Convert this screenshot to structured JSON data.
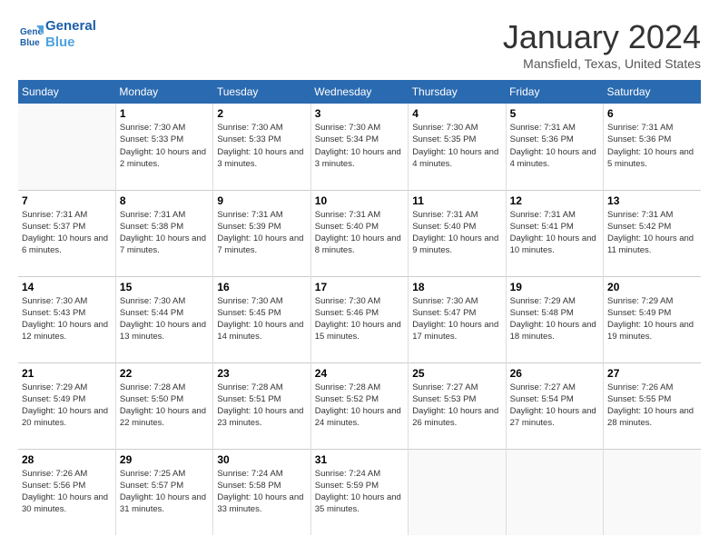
{
  "header": {
    "logo_line1": "General",
    "logo_line2": "Blue",
    "month": "January 2024",
    "location": "Mansfield, Texas, United States"
  },
  "days_of_week": [
    "Sunday",
    "Monday",
    "Tuesday",
    "Wednesday",
    "Thursday",
    "Friday",
    "Saturday"
  ],
  "weeks": [
    [
      {
        "day": "",
        "empty": true
      },
      {
        "day": "1",
        "sunrise": "7:30 AM",
        "sunset": "5:33 PM",
        "daylight": "10 hours and 2 minutes."
      },
      {
        "day": "2",
        "sunrise": "7:30 AM",
        "sunset": "5:33 PM",
        "daylight": "10 hours and 3 minutes."
      },
      {
        "day": "3",
        "sunrise": "7:30 AM",
        "sunset": "5:34 PM",
        "daylight": "10 hours and 3 minutes."
      },
      {
        "day": "4",
        "sunrise": "7:30 AM",
        "sunset": "5:35 PM",
        "daylight": "10 hours and 4 minutes."
      },
      {
        "day": "5",
        "sunrise": "7:31 AM",
        "sunset": "5:36 PM",
        "daylight": "10 hours and 4 minutes."
      },
      {
        "day": "6",
        "sunrise": "7:31 AM",
        "sunset": "5:36 PM",
        "daylight": "10 hours and 5 minutes."
      }
    ],
    [
      {
        "day": "7",
        "sunrise": "7:31 AM",
        "sunset": "5:37 PM",
        "daylight": "10 hours and 6 minutes."
      },
      {
        "day": "8",
        "sunrise": "7:31 AM",
        "sunset": "5:38 PM",
        "daylight": "10 hours and 7 minutes."
      },
      {
        "day": "9",
        "sunrise": "7:31 AM",
        "sunset": "5:39 PM",
        "daylight": "10 hours and 7 minutes."
      },
      {
        "day": "10",
        "sunrise": "7:31 AM",
        "sunset": "5:40 PM",
        "daylight": "10 hours and 8 minutes."
      },
      {
        "day": "11",
        "sunrise": "7:31 AM",
        "sunset": "5:40 PM",
        "daylight": "10 hours and 9 minutes."
      },
      {
        "day": "12",
        "sunrise": "7:31 AM",
        "sunset": "5:41 PM",
        "daylight": "10 hours and 10 minutes."
      },
      {
        "day": "13",
        "sunrise": "7:31 AM",
        "sunset": "5:42 PM",
        "daylight": "10 hours and 11 minutes."
      }
    ],
    [
      {
        "day": "14",
        "sunrise": "7:30 AM",
        "sunset": "5:43 PM",
        "daylight": "10 hours and 12 minutes."
      },
      {
        "day": "15",
        "sunrise": "7:30 AM",
        "sunset": "5:44 PM",
        "daylight": "10 hours and 13 minutes."
      },
      {
        "day": "16",
        "sunrise": "7:30 AM",
        "sunset": "5:45 PM",
        "daylight": "10 hours and 14 minutes."
      },
      {
        "day": "17",
        "sunrise": "7:30 AM",
        "sunset": "5:46 PM",
        "daylight": "10 hours and 15 minutes."
      },
      {
        "day": "18",
        "sunrise": "7:30 AM",
        "sunset": "5:47 PM",
        "daylight": "10 hours and 17 minutes."
      },
      {
        "day": "19",
        "sunrise": "7:29 AM",
        "sunset": "5:48 PM",
        "daylight": "10 hours and 18 minutes."
      },
      {
        "day": "20",
        "sunrise": "7:29 AM",
        "sunset": "5:49 PM",
        "daylight": "10 hours and 19 minutes."
      }
    ],
    [
      {
        "day": "21",
        "sunrise": "7:29 AM",
        "sunset": "5:49 PM",
        "daylight": "10 hours and 20 minutes."
      },
      {
        "day": "22",
        "sunrise": "7:28 AM",
        "sunset": "5:50 PM",
        "daylight": "10 hours and 22 minutes."
      },
      {
        "day": "23",
        "sunrise": "7:28 AM",
        "sunset": "5:51 PM",
        "daylight": "10 hours and 23 minutes."
      },
      {
        "day": "24",
        "sunrise": "7:28 AM",
        "sunset": "5:52 PM",
        "daylight": "10 hours and 24 minutes."
      },
      {
        "day": "25",
        "sunrise": "7:27 AM",
        "sunset": "5:53 PM",
        "daylight": "10 hours and 26 minutes."
      },
      {
        "day": "26",
        "sunrise": "7:27 AM",
        "sunset": "5:54 PM",
        "daylight": "10 hours and 27 minutes."
      },
      {
        "day": "27",
        "sunrise": "7:26 AM",
        "sunset": "5:55 PM",
        "daylight": "10 hours and 28 minutes."
      }
    ],
    [
      {
        "day": "28",
        "sunrise": "7:26 AM",
        "sunset": "5:56 PM",
        "daylight": "10 hours and 30 minutes."
      },
      {
        "day": "29",
        "sunrise": "7:25 AM",
        "sunset": "5:57 PM",
        "daylight": "10 hours and 31 minutes."
      },
      {
        "day": "30",
        "sunrise": "7:24 AM",
        "sunset": "5:58 PM",
        "daylight": "10 hours and 33 minutes."
      },
      {
        "day": "31",
        "sunrise": "7:24 AM",
        "sunset": "5:59 PM",
        "daylight": "10 hours and 35 minutes."
      },
      {
        "day": "",
        "empty": true
      },
      {
        "day": "",
        "empty": true
      },
      {
        "day": "",
        "empty": true
      }
    ]
  ]
}
